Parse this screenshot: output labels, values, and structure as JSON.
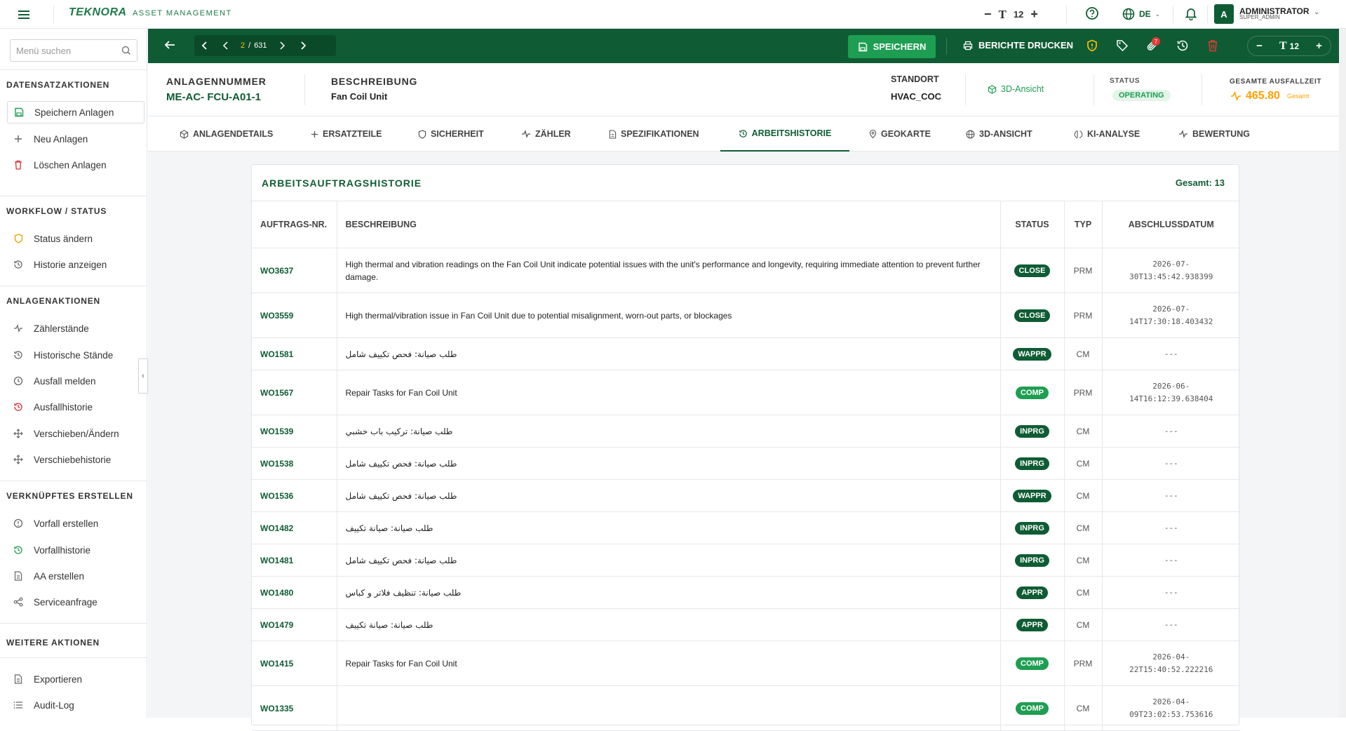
{
  "topbar": {
    "logo": "TEKNORA",
    "logo_sub": "ASSET MANAGEMENT",
    "font_size": "12",
    "language": "DE",
    "avatar_letter": "A",
    "admin_name": "ADMINISTRATOR",
    "admin_role": "SUPER_ADMIN"
  },
  "sidebar": {
    "search_placeholder": "Menü suchen",
    "sections": [
      {
        "title": "DATENSATZAKTIONEN",
        "items": [
          "Speichern Anlagen",
          "Neu Anlagen",
          "Löschen Anlagen"
        ]
      },
      {
        "title": "WORKFLOW / STATUS",
        "items": [
          "Status ändern",
          "Historie anzeigen"
        ]
      },
      {
        "title": "ANLAGENAKTIONEN",
        "items": [
          "Zählerstände",
          "Historische Stände",
          "Ausfall melden",
          "Ausfallhistorie",
          "Verschieben/Ändern",
          "Verschiebehistorie"
        ]
      },
      {
        "title": "VERKNÜPFTES ERSTELLEN",
        "items": [
          "Vorfall erstellen",
          "Vorfallhistorie",
          "AA erstellen",
          "Serviceanfrage"
        ]
      },
      {
        "title": "WEITERE AKTIONEN",
        "items": [
          "Exportieren",
          "Audit-Log"
        ]
      }
    ]
  },
  "actionbar": {
    "page_current": "2",
    "page_sep": "/",
    "page_total": "631",
    "save_label": "SPEICHERN",
    "print_label": "BERICHTE DRUCKEN",
    "attach_badge": "7",
    "font_size": "12"
  },
  "info": {
    "asset_label": "ANLAGENNUMMER",
    "asset_value": "ME-AC- FCU-A01-1",
    "desc_label": "BESCHREIBUNG",
    "desc_value": "Fan Coil Unit",
    "location_label": "STANDORT",
    "location_value": "HVAC_COC",
    "view3d": "3D-Ansicht",
    "status_label": "STATUS",
    "status_value": "OPERATING",
    "downtime_label": "GESAMTE AUSFALLZEIT",
    "downtime_value": "465.80",
    "downtime_unit": "Gesamt"
  },
  "tabs": [
    "ANLAGENDETAILS",
    "ERSATZTEILE",
    "SICHERHEIT",
    "ZÄHLER",
    "SPEZIFIKATIONEN",
    "ARBEITSHISTORIE",
    "GEOKARTE",
    "3D-ANSICHT",
    "KI-ANALYSE",
    "BEWERTUNG"
  ],
  "workorders": {
    "title": "ARBEITSAUFTRAGSHISTORIE",
    "total": "Gesamt: 13",
    "headers": [
      "AUFTRAGS-NR.",
      "BESCHREIBUNG",
      "STATUS",
      "TYP",
      "ABSCHLUSSDATUM"
    ],
    "rows": [
      {
        "wo": "WO3637",
        "desc": "High thermal and vibration readings on the Fan Coil Unit indicate potential issues with the unit's performance and longevity, requiring immediate attention to prevent further damage.",
        "status": "CLOSE",
        "typ": "PRM",
        "date": "2026-07-30T13:45:42.938399"
      },
      {
        "wo": "WO3559",
        "desc": "High thermal/vibration issue in Fan Coil Unit due to potential misalignment, worn-out parts, or blockages",
        "status": "CLOSE",
        "typ": "PRM",
        "date": "2026-07-14T17:30:18.403432"
      },
      {
        "wo": "WO1581",
        "desc": "طلب صيانة: فحص تكييف شامل",
        "status": "WAPPR",
        "typ": "CM",
        "date": "---"
      },
      {
        "wo": "WO1567",
        "desc": "Repair Tasks for Fan Coil Unit",
        "status": "COMP",
        "typ": "PRM",
        "date": "2026-06-14T16:12:39.638404"
      },
      {
        "wo": "WO1539",
        "desc": "طلب صيانة: تركيب باب خشبي",
        "status": "INPRG",
        "typ": "CM",
        "date": "---"
      },
      {
        "wo": "WO1538",
        "desc": "طلب صيانة: فحص تكييف شامل",
        "status": "INPRG",
        "typ": "CM",
        "date": "---"
      },
      {
        "wo": "WO1536",
        "desc": "طلب صيانة: فحص تكييف شامل",
        "status": "WAPPR",
        "typ": "CM",
        "date": "---"
      },
      {
        "wo": "WO1482",
        "desc": "طلب صيانة: صيانة تكييف",
        "status": "INPRG",
        "typ": "CM",
        "date": "---"
      },
      {
        "wo": "WO1481",
        "desc": "طلب صيانة: فحص تكييف شامل",
        "status": "INPRG",
        "typ": "CM",
        "date": "---"
      },
      {
        "wo": "WO1480",
        "desc": "طلب صيانة: تنظيف فلاتر و كباس",
        "status": "APPR",
        "typ": "CM",
        "date": "---"
      },
      {
        "wo": "WO1479",
        "desc": "طلب صيانة: صيانة تكييف",
        "status": "APPR",
        "typ": "CM",
        "date": "---"
      },
      {
        "wo": "WO1415",
        "desc": "Repair Tasks for Fan Coil Unit",
        "status": "COMP",
        "typ": "PRM",
        "date": "2026-04-22T15:40:52.222216"
      },
      {
        "wo": "WO1335",
        "desc": "",
        "status": "COMP",
        "typ": "CM",
        "date": "2026-04-09T23:02:53.753616"
      }
    ]
  }
}
